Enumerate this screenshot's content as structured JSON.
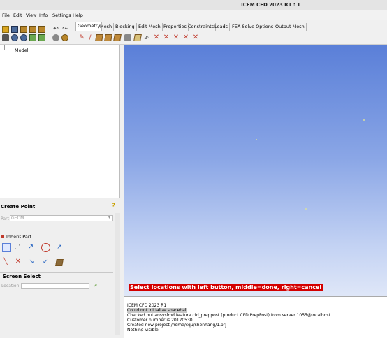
{
  "window": {
    "title": "ICEM CFD 2023 R1 : 1"
  },
  "menu": [
    "File",
    "Edit",
    "View",
    "Info",
    "Settings",
    "Help"
  ],
  "tabs": [
    "Geometry",
    "Mesh",
    "Blocking",
    "Edit Mesh",
    "Properties",
    "Constraints",
    "Loads",
    "FEA Solve Options",
    "Output Mesh"
  ],
  "tree": {
    "root": "Model"
  },
  "panel": {
    "title": "Create Point",
    "part_label": "Part",
    "part_value": "GEOM",
    "inherit_label": "Inherit Part",
    "screen_select_title": "Screen Select",
    "location_label": "Location",
    "browse_label": "..."
  },
  "viewport": {
    "prompt": "Select locations with left button, middle=done, right=cancel"
  },
  "console": [
    "ICEM CFD 2023 R1",
    "Could not initialize spaceball",
    "Checked out ansyslmd feature cfd_preppost (product CFD PrepPost) from server 1055@localhost",
    "Customer number is 20120530",
    "Created new project /home/cqu/shenhang/1.prj",
    "Nothing visible"
  ],
  "colors": {
    "prompt_bg": "#d40000",
    "viewport_top": "#5a7fd8",
    "viewport_bottom": "#dfe7f8"
  }
}
